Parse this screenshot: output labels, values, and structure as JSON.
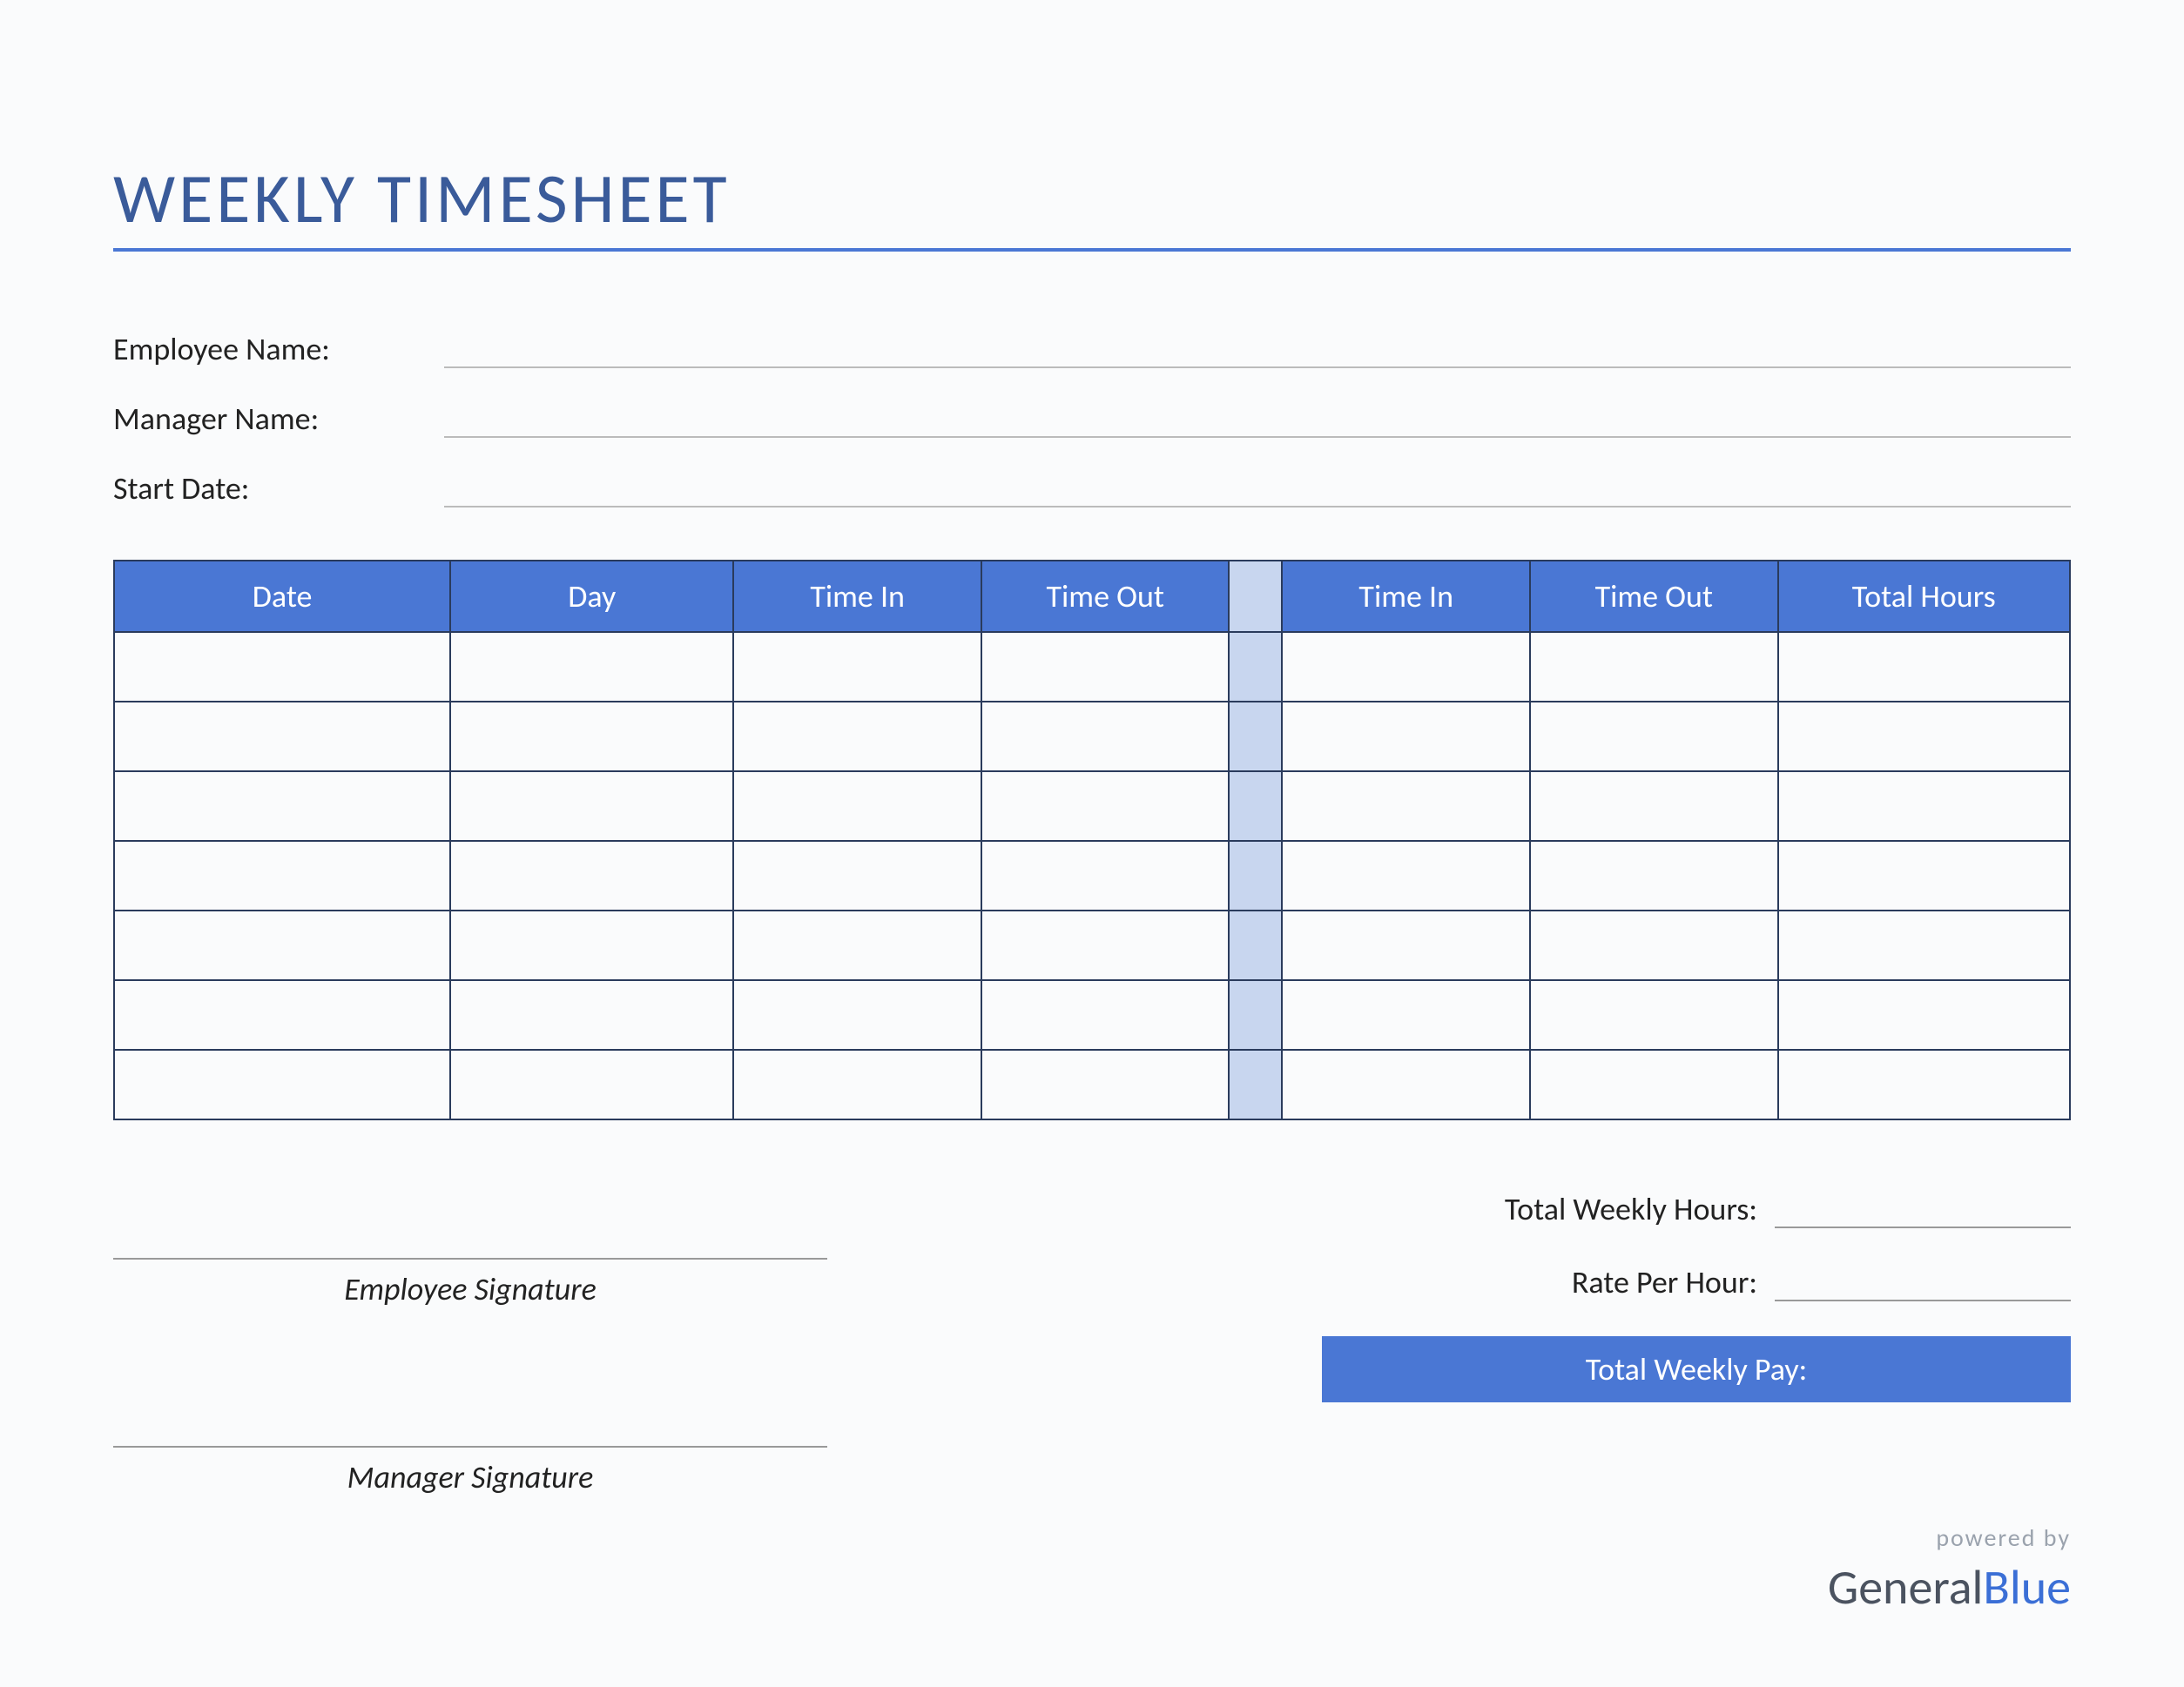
{
  "title": "WEEKLY TIMESHEET",
  "info": {
    "employee_label": "Employee Name:",
    "employee_value": "",
    "manager_label": "Manager Name:",
    "manager_value": "",
    "startdate_label": "Start Date:",
    "startdate_value": ""
  },
  "table": {
    "headers": {
      "date": "Date",
      "day": "Day",
      "time_in_1": "Time In",
      "time_out_1": "Time Out",
      "gap": "",
      "time_in_2": "Time In",
      "time_out_2": "Time Out",
      "total": "Total Hours"
    },
    "rows": [
      {
        "date": "",
        "day": "",
        "in1": "",
        "out1": "",
        "in2": "",
        "out2": "",
        "total": ""
      },
      {
        "date": "",
        "day": "",
        "in1": "",
        "out1": "",
        "in2": "",
        "out2": "",
        "total": ""
      },
      {
        "date": "",
        "day": "",
        "in1": "",
        "out1": "",
        "in2": "",
        "out2": "",
        "total": ""
      },
      {
        "date": "",
        "day": "",
        "in1": "",
        "out1": "",
        "in2": "",
        "out2": "",
        "total": ""
      },
      {
        "date": "",
        "day": "",
        "in1": "",
        "out1": "",
        "in2": "",
        "out2": "",
        "total": ""
      },
      {
        "date": "",
        "day": "",
        "in1": "",
        "out1": "",
        "in2": "",
        "out2": "",
        "total": ""
      },
      {
        "date": "",
        "day": "",
        "in1": "",
        "out1": "",
        "in2": "",
        "out2": "",
        "total": ""
      }
    ]
  },
  "signatures": {
    "employee": "Employee Signature",
    "manager": "Manager Signature"
  },
  "totals": {
    "weekly_hours_label": "Total Weekly Hours:",
    "weekly_hours_value": "",
    "rate_label": "Rate Per Hour:",
    "rate_value": "",
    "pay_label": "Total Weekly Pay:",
    "pay_value": ""
  },
  "footer": {
    "powered": "powered by",
    "logo_a": "General",
    "logo_b": "Blue"
  }
}
